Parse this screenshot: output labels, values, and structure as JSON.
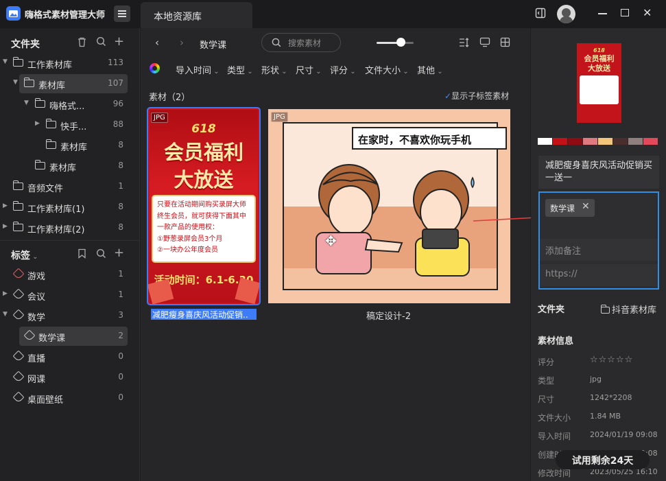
{
  "app": {
    "title": "嗨格式素材管理大师",
    "tab": "本地资源库"
  },
  "sidebar": {
    "folders_heading": "文件夹",
    "folders": [
      {
        "label": "工作素材库",
        "count": "113"
      },
      {
        "label": "素材库",
        "count": "107"
      },
      {
        "label": "嗨格式...",
        "count": "96"
      },
      {
        "label": "快手...",
        "count": "88"
      },
      {
        "label": "素材库",
        "count": "8"
      },
      {
        "label": "素材库",
        "count": "8"
      },
      {
        "label": "音频文件",
        "count": "1"
      },
      {
        "label": "工作素材库(1)",
        "count": "8"
      },
      {
        "label": "工作素材库(2)",
        "count": "8"
      }
    ],
    "tags_heading": "标签",
    "tags": [
      {
        "label": "游戏",
        "count": "1"
      },
      {
        "label": "会议",
        "count": "1"
      },
      {
        "label": "数学",
        "count": "3"
      },
      {
        "label": "数学课",
        "count": "2"
      },
      {
        "label": "直播",
        "count": "0"
      },
      {
        "label": "网课",
        "count": "0"
      },
      {
        "label": "桌面壁纸",
        "count": "0"
      }
    ]
  },
  "toolbar": {
    "breadcrumb": "数学课",
    "search_placeholder": "搜索素材",
    "zoom_level": 0.65
  },
  "filters": [
    "导入时间",
    "类型",
    "形状",
    "尺寸",
    "评分",
    "文件大小",
    "其他"
  ],
  "content": {
    "count_label": "素材（2）",
    "show_sub_tags": "显示子标签素材",
    "items": [
      {
        "badge": "JPG",
        "name": "减肥瘦身喜庆风活动促销..",
        "image_text": {
          "big": "618",
          "title1": "会员福利",
          "title2": "大放送",
          "body": [
            "只要在活动期间购买录屏大师",
            "终生会员，就可获得下面其中",
            "一款产品的使用权：",
            "①野葱录屏会员3个月",
            "②一块办公年度会员"
          ],
          "date": "活动时间：6.1-6.30"
        }
      },
      {
        "badge": "JPG",
        "name": "稿定设计-2",
        "image_text": {
          "bubble": "在家时，不喜欢你玩手机"
        }
      }
    ]
  },
  "panel": {
    "palette": [
      "#ffffff",
      "#c41118",
      "#8e0b12",
      "#e07a80",
      "#f2c57a",
      "#4a2d2d",
      "#8f7f7f",
      "#e24a5c"
    ],
    "title": "减肥瘦身喜庆风活动促销买一送一",
    "tag": "数学课",
    "note_placeholder": "添加备注",
    "url_placeholder": "https://",
    "folder_label": "文件夹",
    "folder_value": "抖音素材库",
    "info_heading": "素材信息",
    "info": [
      {
        "key": "评分",
        "value": "☆☆☆☆☆"
      },
      {
        "key": "类型",
        "value": "jpg"
      },
      {
        "key": "尺寸",
        "value": "1242*2208"
      },
      {
        "key": "文件大小",
        "value": "1.84 MB"
      },
      {
        "key": "导入时间",
        "value": "2024/01/19 09:08"
      },
      {
        "key": "创建时间",
        "value": "2024/01/19 09:08"
      },
      {
        "key": "修改时间",
        "value": "2023/05/25 16:10"
      }
    ],
    "trial": "试用剩余24天"
  }
}
